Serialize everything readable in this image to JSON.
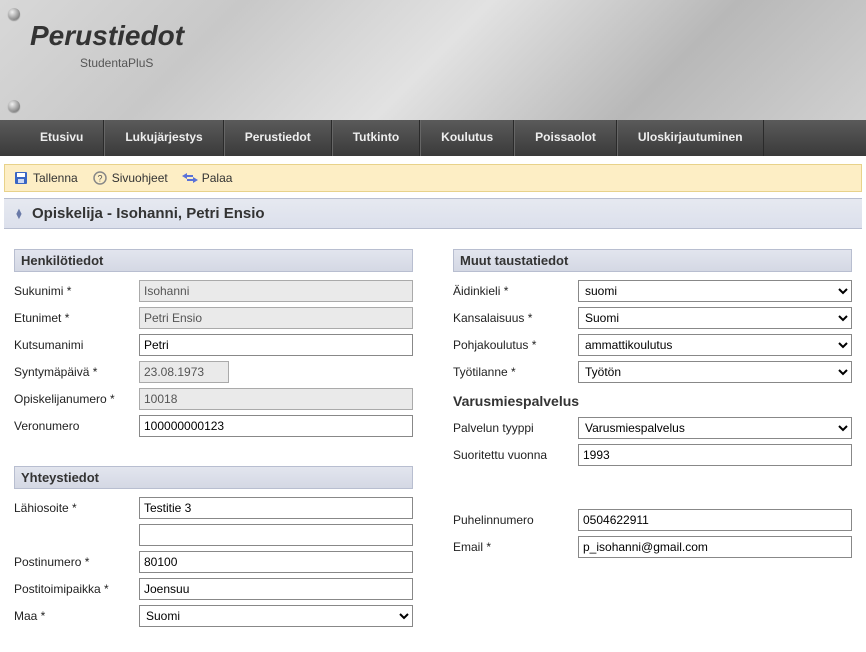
{
  "header": {
    "title": "Perustiedot",
    "subtitle": "StudentaPluS"
  },
  "nav": [
    "Etusivu",
    "Lukujärjestys",
    "Perustiedot",
    "Tutkinto",
    "Koulutus",
    "Poissaolot",
    "Uloskirjautuminen"
  ],
  "toolbar": {
    "save": "Tallenna",
    "help": "Sivuohjeet",
    "back": "Palaa"
  },
  "section_title": "Opiskelija - Isohanni, Petri Ensio",
  "groups": {
    "henkilo": "Henkilötiedot",
    "tausta": "Muut taustatiedot",
    "varus": "Varusmiespalvelus",
    "yhteys": "Yhteystiedot"
  },
  "labels": {
    "sukunimi": "Sukunimi *",
    "etunimet": "Etunimet *",
    "kutsumanimi": "Kutsumanimi",
    "syntymapaiva": "Syntymäpäivä *",
    "opnum": "Opiskelijanumero *",
    "veronumero": "Veronumero",
    "aidinkieli": "Äidinkieli *",
    "kansalaisuus": "Kansalaisuus *",
    "pohjakoulutus": "Pohjakoulutus *",
    "tyotilanne": "Työtilanne *",
    "palvelutyyppi": "Palvelun tyyppi",
    "suoritettu": "Suoritettu vuonna",
    "lahiosoite": "Lähiosoite *",
    "postinumero": "Postinumero *",
    "postitoimipaikka": "Postitoimipaikka *",
    "maa": "Maa *",
    "puhelin": "Puhelinnumero",
    "email": "Email *"
  },
  "values": {
    "sukunimi": "Isohanni",
    "etunimet": "Petri Ensio",
    "kutsumanimi": "Petri",
    "syntymapaiva": "23.08.1973",
    "opnum": "10018",
    "veronumero": "100000000123",
    "aidinkieli": "suomi",
    "kansalaisuus": "Suomi",
    "pohjakoulutus": "ammattikoulutus",
    "tyotilanne": "Työtön",
    "palvelutyyppi": "Varusmiespalvelus",
    "suoritettu": "1993",
    "lahiosoite": "Testitie 3",
    "lahiosoite2": "",
    "postinumero": "80100",
    "postitoimipaikka": "Joensuu",
    "maa": "Suomi",
    "puhelin": "0504622911",
    "email": "p_isohanni@gmail.com"
  }
}
